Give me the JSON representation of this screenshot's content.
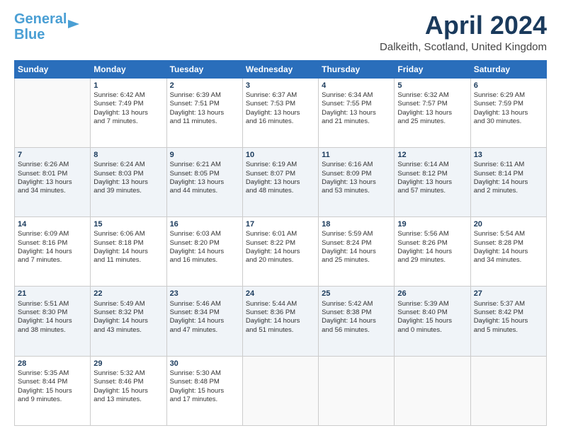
{
  "logo": {
    "line1": "General",
    "line2": "Blue"
  },
  "title": "April 2024",
  "location": "Dalkeith, Scotland, United Kingdom",
  "days_header": [
    "Sunday",
    "Monday",
    "Tuesday",
    "Wednesday",
    "Thursday",
    "Friday",
    "Saturday"
  ],
  "weeks": [
    [
      {
        "day": "",
        "info": ""
      },
      {
        "day": "1",
        "info": "Sunrise: 6:42 AM\nSunset: 7:49 PM\nDaylight: 13 hours\nand 7 minutes."
      },
      {
        "day": "2",
        "info": "Sunrise: 6:39 AM\nSunset: 7:51 PM\nDaylight: 13 hours\nand 11 minutes."
      },
      {
        "day": "3",
        "info": "Sunrise: 6:37 AM\nSunset: 7:53 PM\nDaylight: 13 hours\nand 16 minutes."
      },
      {
        "day": "4",
        "info": "Sunrise: 6:34 AM\nSunset: 7:55 PM\nDaylight: 13 hours\nand 21 minutes."
      },
      {
        "day": "5",
        "info": "Sunrise: 6:32 AM\nSunset: 7:57 PM\nDaylight: 13 hours\nand 25 minutes."
      },
      {
        "day": "6",
        "info": "Sunrise: 6:29 AM\nSunset: 7:59 PM\nDaylight: 13 hours\nand 30 minutes."
      }
    ],
    [
      {
        "day": "7",
        "info": "Sunrise: 6:26 AM\nSunset: 8:01 PM\nDaylight: 13 hours\nand 34 minutes."
      },
      {
        "day": "8",
        "info": "Sunrise: 6:24 AM\nSunset: 8:03 PM\nDaylight: 13 hours\nand 39 minutes."
      },
      {
        "day": "9",
        "info": "Sunrise: 6:21 AM\nSunset: 8:05 PM\nDaylight: 13 hours\nand 44 minutes."
      },
      {
        "day": "10",
        "info": "Sunrise: 6:19 AM\nSunset: 8:07 PM\nDaylight: 13 hours\nand 48 minutes."
      },
      {
        "day": "11",
        "info": "Sunrise: 6:16 AM\nSunset: 8:09 PM\nDaylight: 13 hours\nand 53 minutes."
      },
      {
        "day": "12",
        "info": "Sunrise: 6:14 AM\nSunset: 8:12 PM\nDaylight: 13 hours\nand 57 minutes."
      },
      {
        "day": "13",
        "info": "Sunrise: 6:11 AM\nSunset: 8:14 PM\nDaylight: 14 hours\nand 2 minutes."
      }
    ],
    [
      {
        "day": "14",
        "info": "Sunrise: 6:09 AM\nSunset: 8:16 PM\nDaylight: 14 hours\nand 7 minutes."
      },
      {
        "day": "15",
        "info": "Sunrise: 6:06 AM\nSunset: 8:18 PM\nDaylight: 14 hours\nand 11 minutes."
      },
      {
        "day": "16",
        "info": "Sunrise: 6:03 AM\nSunset: 8:20 PM\nDaylight: 14 hours\nand 16 minutes."
      },
      {
        "day": "17",
        "info": "Sunrise: 6:01 AM\nSunset: 8:22 PM\nDaylight: 14 hours\nand 20 minutes."
      },
      {
        "day": "18",
        "info": "Sunrise: 5:59 AM\nSunset: 8:24 PM\nDaylight: 14 hours\nand 25 minutes."
      },
      {
        "day": "19",
        "info": "Sunrise: 5:56 AM\nSunset: 8:26 PM\nDaylight: 14 hours\nand 29 minutes."
      },
      {
        "day": "20",
        "info": "Sunrise: 5:54 AM\nSunset: 8:28 PM\nDaylight: 14 hours\nand 34 minutes."
      }
    ],
    [
      {
        "day": "21",
        "info": "Sunrise: 5:51 AM\nSunset: 8:30 PM\nDaylight: 14 hours\nand 38 minutes."
      },
      {
        "day": "22",
        "info": "Sunrise: 5:49 AM\nSunset: 8:32 PM\nDaylight: 14 hours\nand 43 minutes."
      },
      {
        "day": "23",
        "info": "Sunrise: 5:46 AM\nSunset: 8:34 PM\nDaylight: 14 hours\nand 47 minutes."
      },
      {
        "day": "24",
        "info": "Sunrise: 5:44 AM\nSunset: 8:36 PM\nDaylight: 14 hours\nand 51 minutes."
      },
      {
        "day": "25",
        "info": "Sunrise: 5:42 AM\nSunset: 8:38 PM\nDaylight: 14 hours\nand 56 minutes."
      },
      {
        "day": "26",
        "info": "Sunrise: 5:39 AM\nSunset: 8:40 PM\nDaylight: 15 hours\nand 0 minutes."
      },
      {
        "day": "27",
        "info": "Sunrise: 5:37 AM\nSunset: 8:42 PM\nDaylight: 15 hours\nand 5 minutes."
      }
    ],
    [
      {
        "day": "28",
        "info": "Sunrise: 5:35 AM\nSunset: 8:44 PM\nDaylight: 15 hours\nand 9 minutes."
      },
      {
        "day": "29",
        "info": "Sunrise: 5:32 AM\nSunset: 8:46 PM\nDaylight: 15 hours\nand 13 minutes."
      },
      {
        "day": "30",
        "info": "Sunrise: 5:30 AM\nSunset: 8:48 PM\nDaylight: 15 hours\nand 17 minutes."
      },
      {
        "day": "",
        "info": ""
      },
      {
        "day": "",
        "info": ""
      },
      {
        "day": "",
        "info": ""
      },
      {
        "day": "",
        "info": ""
      }
    ]
  ]
}
